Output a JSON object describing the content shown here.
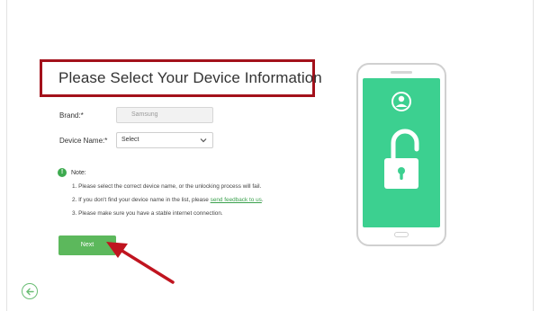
{
  "title": "Please Select Your Device Information",
  "form": {
    "brand_label": "Brand:*",
    "brand_value": "Samsung",
    "device_label": "Device Name:*",
    "device_value": "Select"
  },
  "note": {
    "title": "Note:",
    "item1": "1. Please select the correct device name, or the unlocking process will fail.",
    "item2_prefix": "2. If you don't find your device name in the list, please ",
    "item2_link": "send feedback to us",
    "item2_suffix": ".",
    "item3": "3. Please make sure you have a stable internet connection."
  },
  "next_label": "Next",
  "colors": {
    "accent": "#5cb85c",
    "highlight_box": "#a3111b",
    "phone_screen": "#3cd090",
    "link": "#3aa04c"
  },
  "icons": [
    "info-icon",
    "chevron-down-icon",
    "back-arrow-icon",
    "user-icon",
    "unlocked-padlock-icon",
    "pointer-arrow"
  ]
}
